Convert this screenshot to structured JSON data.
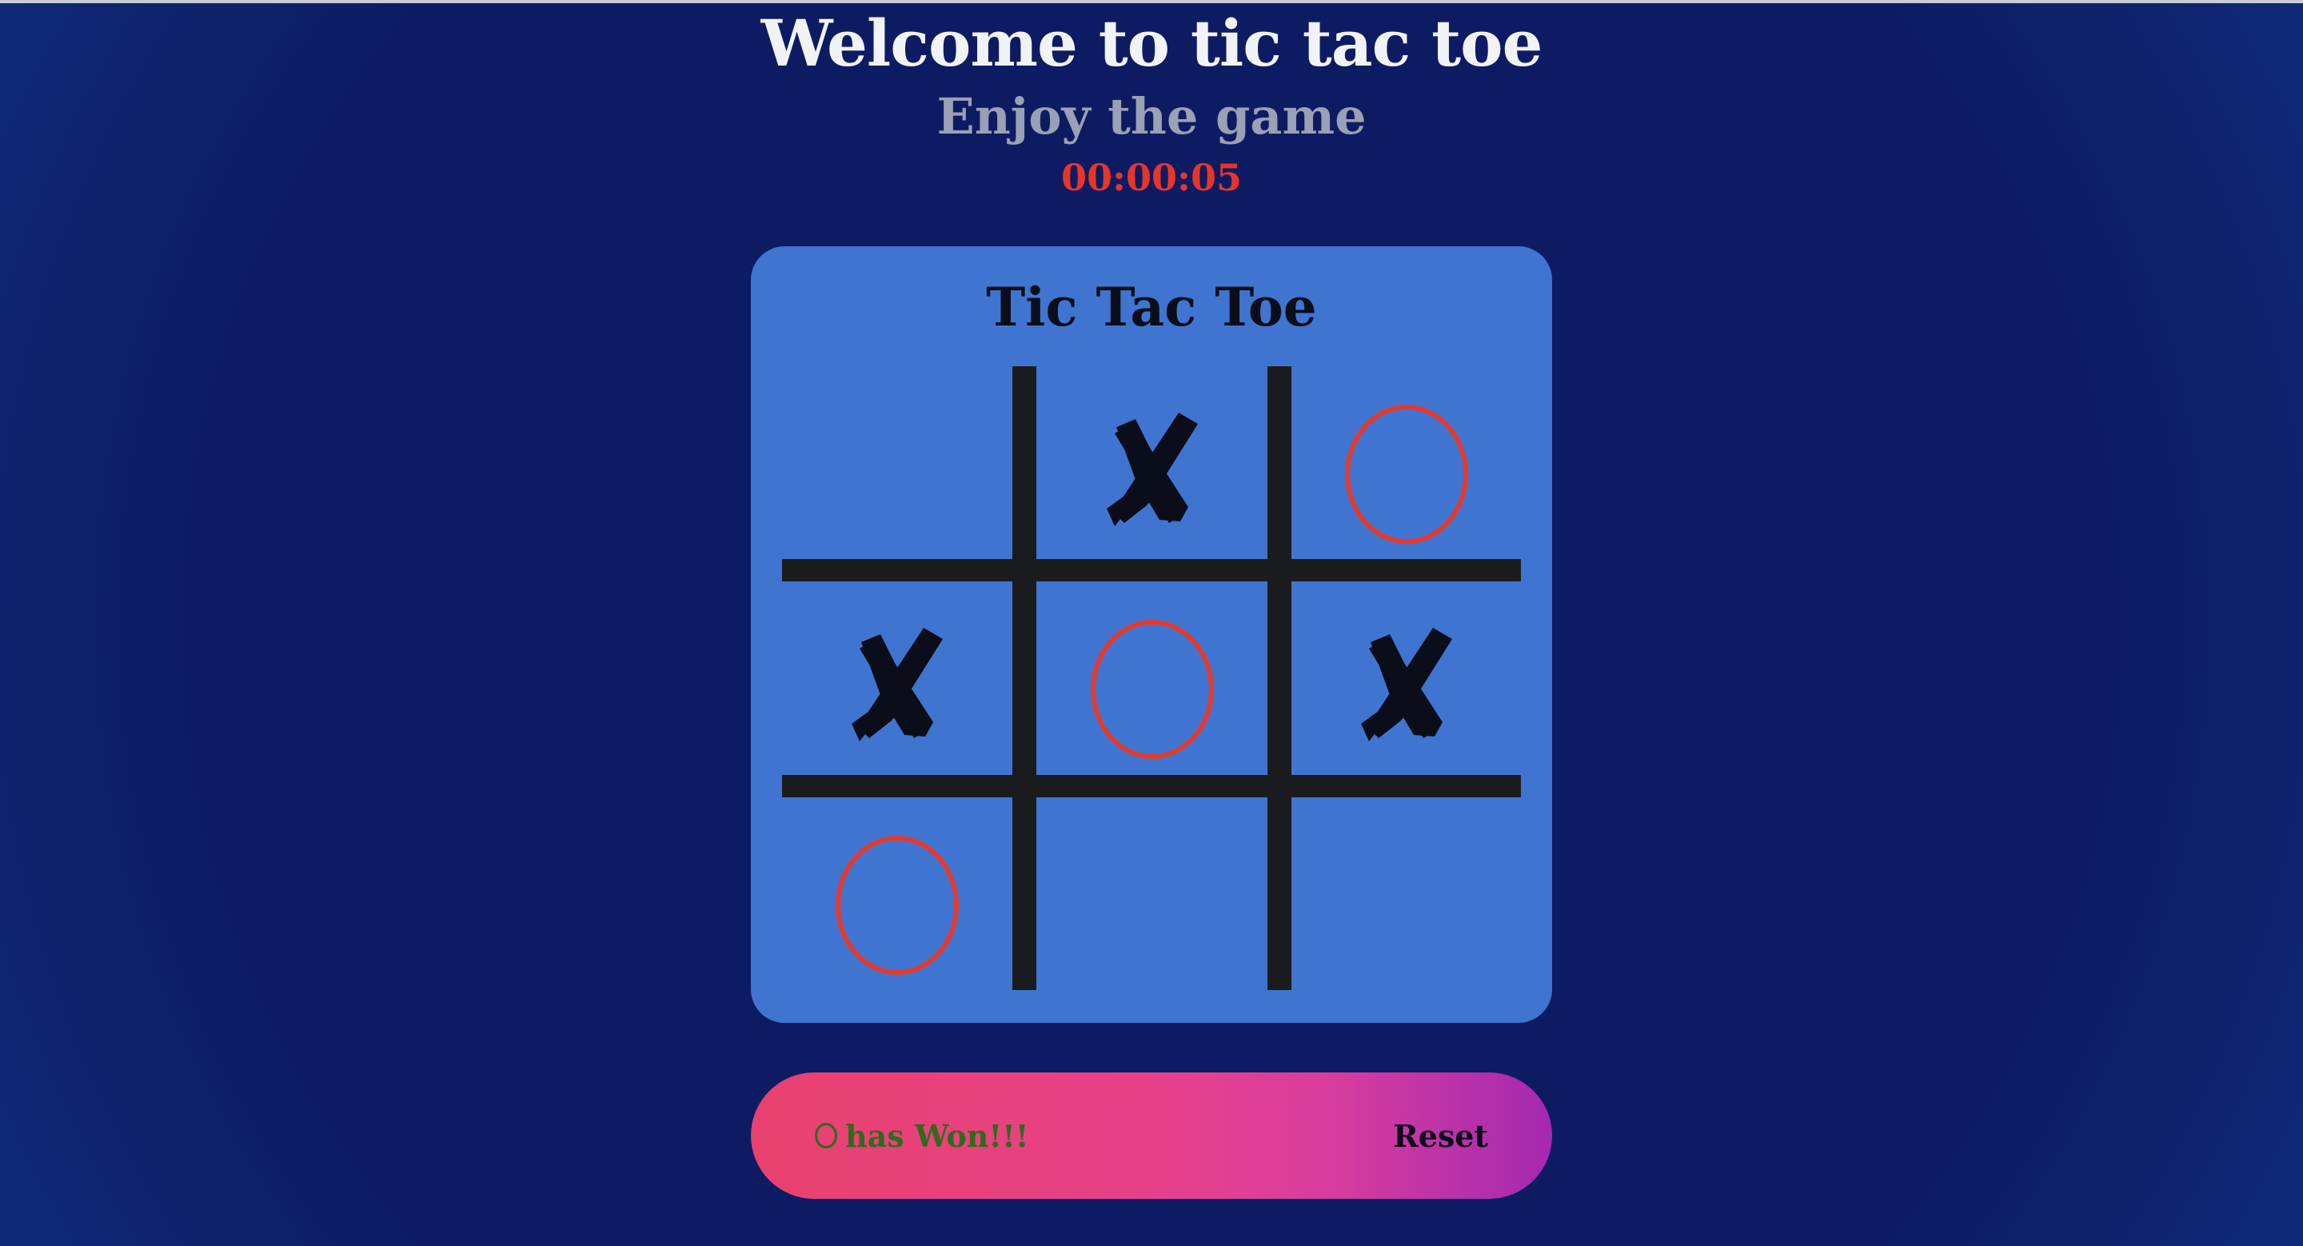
{
  "header": {
    "title": "Welcome to tic tac toe",
    "subtitle": "Enjoy the game",
    "timer": "00:00:05"
  },
  "game": {
    "title": "Tic Tac Toe",
    "board": [
      "",
      "X",
      "O",
      "X",
      "O",
      "X",
      "O",
      "",
      ""
    ]
  },
  "status": {
    "winner_symbol": "O",
    "message": "has Won!!!",
    "reset_label": "Reset"
  },
  "colors": {
    "background": "#0d1c62",
    "card": "#3f75d1",
    "o_mark": "#e23b2e",
    "x_mark": "#0b0e1a",
    "timer": "#e8352a",
    "status_text": "#2f6a1d"
  }
}
